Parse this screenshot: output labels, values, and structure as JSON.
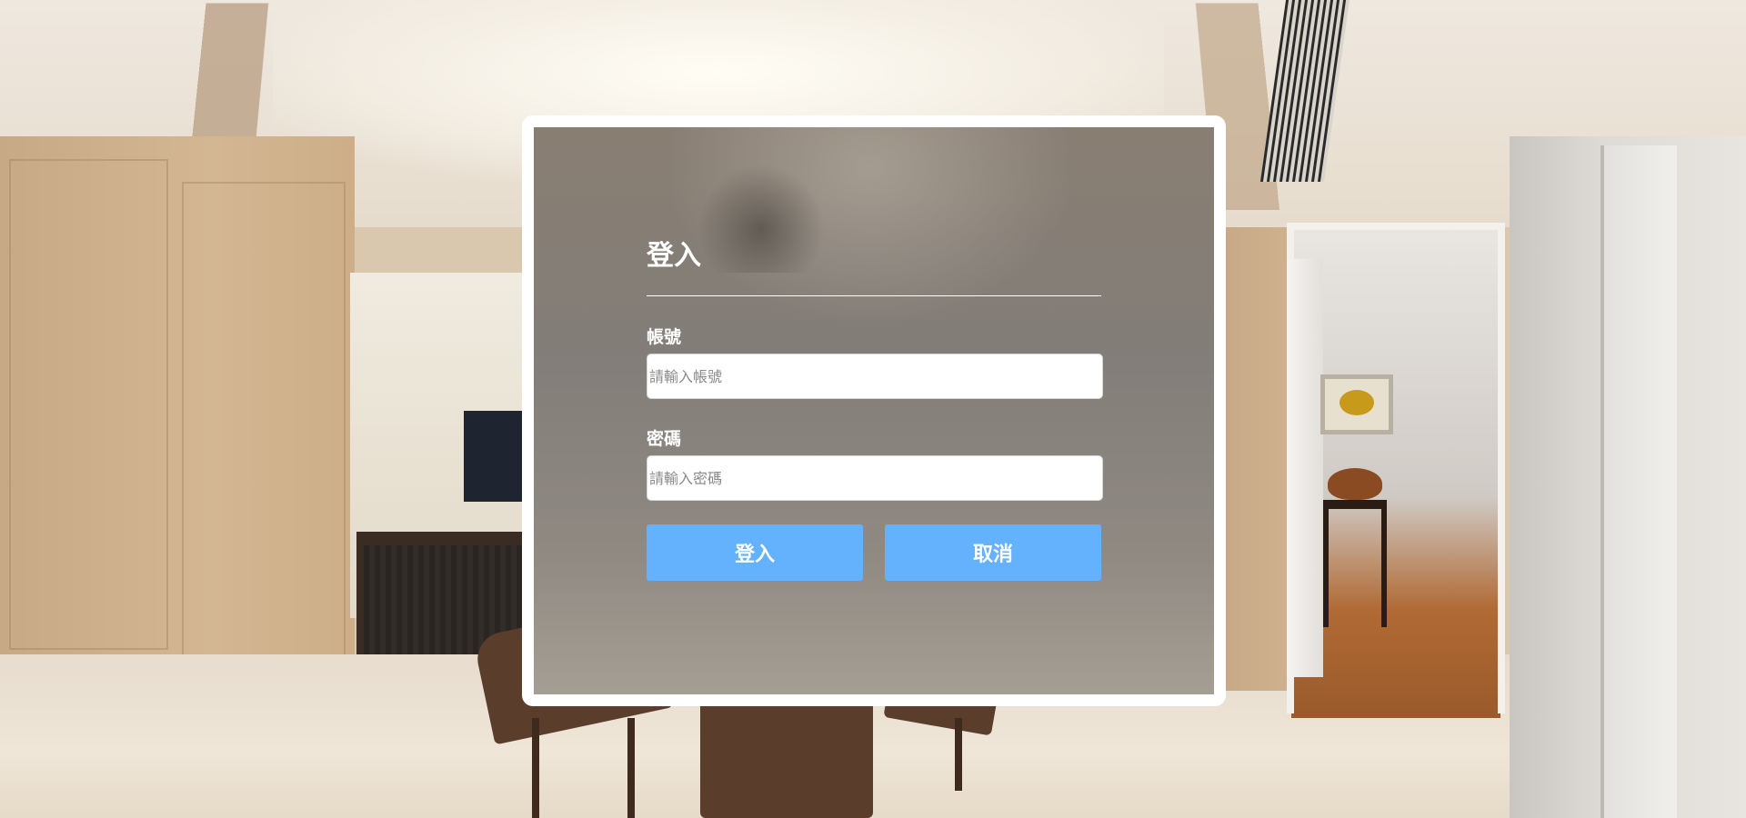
{
  "login": {
    "title": "登入",
    "account": {
      "label": "帳號",
      "placeholder": "請輸入帳號",
      "value": ""
    },
    "password": {
      "label": "密碼",
      "placeholder": "請輸入密碼",
      "value": ""
    },
    "buttons": {
      "login_label": "登入",
      "cancel_label": "取消"
    }
  },
  "colors": {
    "button": "#64b1fd",
    "card_frame": "#ffffff"
  }
}
